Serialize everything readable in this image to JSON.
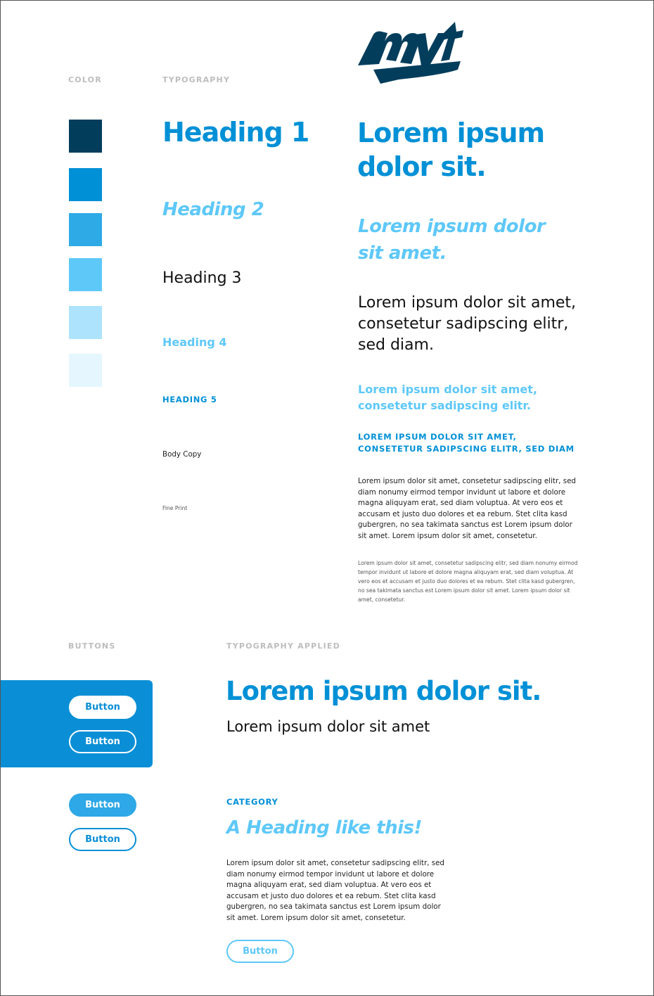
{
  "brand": {
    "logo_text": "mvt",
    "colors": {
      "navy": "#033d5c",
      "primary": "#0090d6",
      "medium": "#2eaae6",
      "light": "#5ec8f8",
      "pale": "#aee3fd",
      "faint": "#e5f6fe"
    }
  },
  "sections": {
    "color": "COLOR",
    "typography": "TYPOGRAPHY",
    "buttons": "BUTTONS",
    "typography_applied": "TYPOGRAPHY APPLIED"
  },
  "swatches": [
    {
      "name": "navy",
      "hex": "#033d5c"
    },
    {
      "name": "primary-blue",
      "hex": "#0090d6"
    },
    {
      "name": "medium-blue",
      "hex": "#2eaae6"
    },
    {
      "name": "light-blue",
      "hex": "#5ec8f8"
    },
    {
      "name": "pale-blue",
      "hex": "#aee3fd"
    },
    {
      "name": "faint-blue",
      "hex": "#e5f6fe"
    }
  ],
  "typography": {
    "labels": {
      "h1": "Heading 1",
      "h2": "Heading 2",
      "h3": "Heading 3",
      "h4": "Heading 4",
      "h5": "HEADING 5",
      "body": "Body Copy",
      "fine": "Fine Print"
    },
    "samples": {
      "h1": "Lorem ipsum dolor sit.",
      "h2": "Lorem ipsum dolor sit amet.",
      "h3": "Lorem ipsum dolor sit amet, consetetur sadipscing elitr, sed diam.",
      "h4": "Lorem ipsum dolor sit amet, consetetur sadipscing elitr.",
      "h5": "LOREM IPSUM DOLOR SIT AMET, CONSETETUR SADIPSCING ELITR, SED DIAM",
      "body": "Lorem ipsum dolor sit amet, consetetur sadipscing elitr, sed diam nonumy eirmod tempor invidunt ut labore et dolore magna aliquyam erat, sed diam voluptua. At vero eos et accusam et justo duo dolores et ea rebum. Stet clita kasd gubergren, no sea takimata sanctus est Lorem ipsum dolor sit amet. Lorem ipsum dolor sit amet, consetetur.",
      "fine": "Lorem ipsum dolor sit amet, consetetur sadipscing elitr, sed diam nonumy eirmod tempor invidunt ut labore et dolore magna aliquyam erat, sed diam voluptua. At vero eos et accusam et justo duo dolores et ea rebum. Stet clita kasd gubergren, no sea takimata sanctus est Lorem ipsum dolor sit amet. Lorem ipsum dolor sit amet, consetetur."
    }
  },
  "buttons": {
    "on_blue_solid": "Button",
    "on_blue_outline": "Button",
    "filled": "Button",
    "outline": "Button"
  },
  "applied": {
    "title": "Lorem ipsum dolor sit.",
    "subtitle": "Lorem ipsum dolor sit amet",
    "category": "CATEGORY",
    "heading": "A Heading like this!",
    "body": "Lorem ipsum dolor sit amet, consetetur sadipscing elitr, sed diam nonumy eirmod tempor invidunt ut labore et dolore magna aliquyam erat, sed diam voluptua. At vero eos et accusam et justo duo dolores et ea rebum. Stet clita kasd gubergren, no sea takimata sanctus est Lorem ipsum dolor sit amet. Lorem ipsum dolor sit amet, consetetur.",
    "button": "Button"
  }
}
